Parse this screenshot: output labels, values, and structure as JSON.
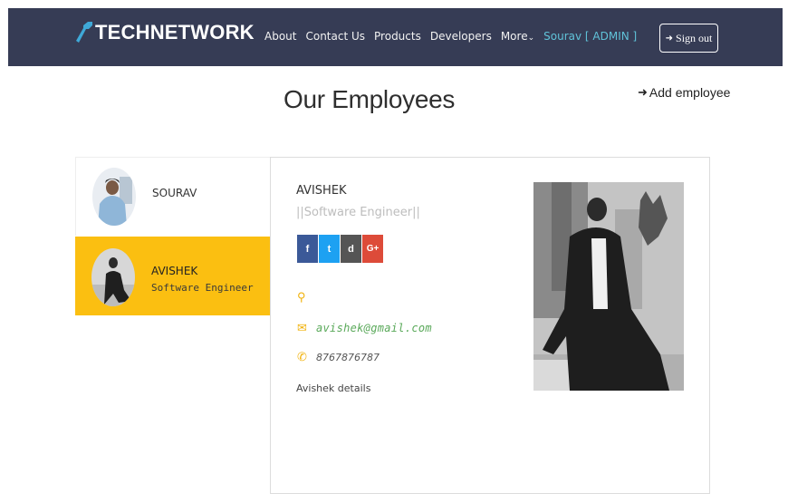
{
  "navbar": {
    "brand": "TECHNETWORK",
    "links": [
      "About",
      "Contact Us",
      "Products",
      "Developers",
      "More"
    ],
    "user": "Sourav [ ADMIN ]",
    "signout_label": "Sign out"
  },
  "page": {
    "title": "Our Employees",
    "add_label": "Add employee"
  },
  "employees": [
    {
      "name": "SOURAV"
    },
    {
      "name": "AVISHEK",
      "role": "Software Engineer"
    }
  ],
  "detail": {
    "name": "AVISHEK",
    "role": "||Software Engineer||",
    "socials": [
      "f",
      "t",
      "d",
      "G+"
    ],
    "email": "avishek@gmail.com",
    "phone": "8767876787",
    "details": "Avishek details"
  },
  "colors": {
    "navbar": "#363c55",
    "accent": "#fbbf11",
    "user_link": "#60c2d8",
    "email": "#5aa95a"
  }
}
